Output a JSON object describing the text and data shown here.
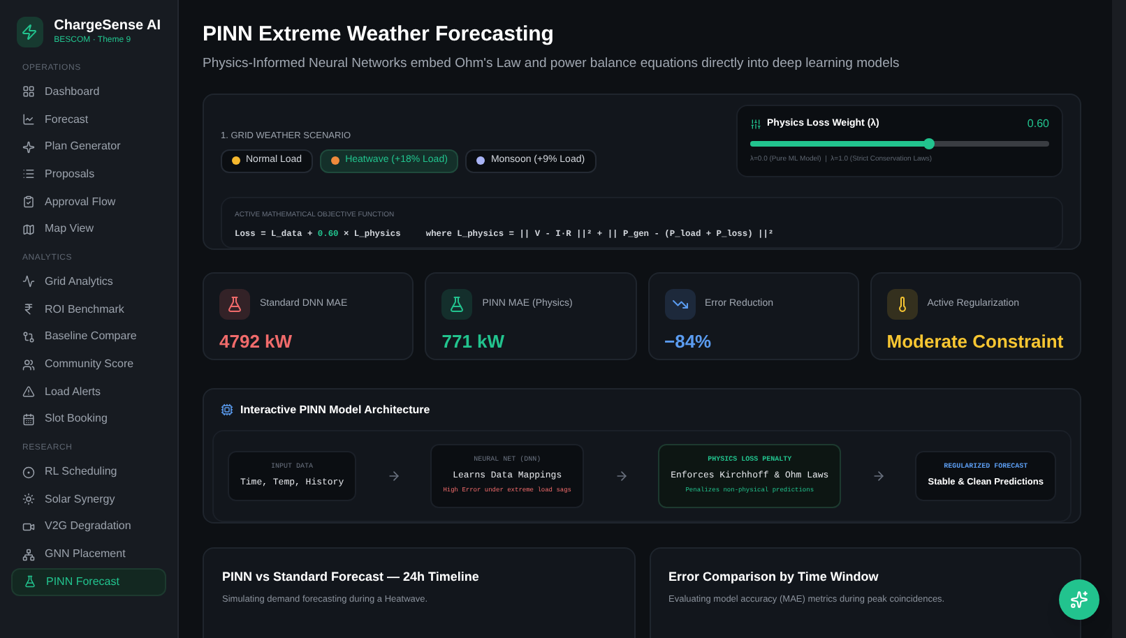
{
  "brand": {
    "name": "ChargeSense AI",
    "subtitle": "BESCOM · Theme 9"
  },
  "sidebar": {
    "sections": [
      {
        "heading": "OPERATIONS",
        "items": [
          {
            "label": "Dashboard",
            "selected": false
          },
          {
            "label": "Forecast",
            "selected": false
          },
          {
            "label": "Plan Generator",
            "selected": false
          },
          {
            "label": "Proposals",
            "selected": false
          },
          {
            "label": "Approval Flow",
            "selected": false
          },
          {
            "label": "Map View",
            "selected": false
          }
        ]
      },
      {
        "heading": "ANALYTICS",
        "items": [
          {
            "label": "Grid Analytics",
            "selected": false
          },
          {
            "label": "ROI Benchmark",
            "selected": false
          },
          {
            "label": "Baseline Compare",
            "selected": false
          },
          {
            "label": "Community Score",
            "selected": false
          },
          {
            "label": "Load Alerts",
            "selected": false
          },
          {
            "label": "Slot Booking",
            "selected": false
          }
        ]
      },
      {
        "heading": "RESEARCH",
        "items": [
          {
            "label": "RL Scheduling",
            "selected": false
          },
          {
            "label": "Solar Synergy",
            "selected": false
          },
          {
            "label": "V2G Degradation",
            "selected": false
          },
          {
            "label": "GNN Placement",
            "selected": false
          },
          {
            "label": "PINN Forecast",
            "selected": true
          }
        ]
      }
    ]
  },
  "page": {
    "title": "PINN Extreme Weather Forecasting",
    "subtitle": "Physics-Informed Neural Networks embed Ohm's Law and power balance equations directly into deep learning models"
  },
  "scenario": {
    "heading": "1. GRID WEATHER SCENARIO",
    "options": [
      {
        "label": "Normal Load",
        "selected": false,
        "color": "#f5b82e"
      },
      {
        "label": "Heatwave (+18% Load)",
        "selected": true,
        "color": "#f08a3c"
      },
      {
        "label": "Monsoon (+9% Load)",
        "selected": false,
        "color": "#a9b4f5"
      }
    ]
  },
  "slider": {
    "label": "Physics Loss Weight (λ)",
    "value": "0.60",
    "level": 0.6,
    "hint": "λ=0.0 (Pure ML Model)  |  λ=1.0 (Strict Conservation Laws)"
  },
  "objective": {
    "heading": "ACTIVE MATHEMATICAL OBJECTIVE FUNCTION",
    "prefix": "Loss = L_data +",
    "weight": "0.60",
    "suffix": "× L_physics",
    "constraint": "where L_physics = || V - I·R ||² + || P_gen - (P_load + P_loss) ||²"
  },
  "stats": [
    {
      "label": "Standard DNN MAE",
      "value": "4792 kW",
      "kind": "flask",
      "color": "#f06b6b"
    },
    {
      "label": "PINN MAE (Physics)",
      "value": "771 kW",
      "kind": "flask",
      "color": "#22c38e"
    },
    {
      "label": "Error Reduction",
      "value": "−84%",
      "kind": "trend",
      "color": "#5b9cf0"
    },
    {
      "label": "Active Regularization",
      "value": "Moderate Constraint",
      "kind": "thermometer",
      "color": "#f7c632"
    }
  ],
  "architecture": {
    "title": "Interactive PINN Model Architecture",
    "nodes": [
      {
        "kind": "input",
        "label": "INPUT DATA",
        "title": "Time, Temp, History"
      },
      {
        "kind": "network",
        "label": "NEURAL NET (DNN)",
        "title": "Learns Data Mappings",
        "note": "High Error under extreme load sags"
      },
      {
        "kind": "physics",
        "label": "PHYSICS LOSS PENALTY",
        "title": "Enforces Kirchhoff & Ohm Laws",
        "note": "Penalizes non-physical predictions"
      },
      {
        "kind": "output",
        "label": "REGULARIZED FORECAST",
        "title": "Stable & Clean Predictions"
      }
    ]
  },
  "panels": [
    {
      "title": "PINN vs Standard Forecast — 24h Timeline",
      "subtitle": "Simulating demand forecasting during a Heatwave."
    },
    {
      "title": "Error Comparison by Time Window",
      "subtitle": "Evaluating model accuracy (MAE) metrics during peak coincidences."
    }
  ]
}
